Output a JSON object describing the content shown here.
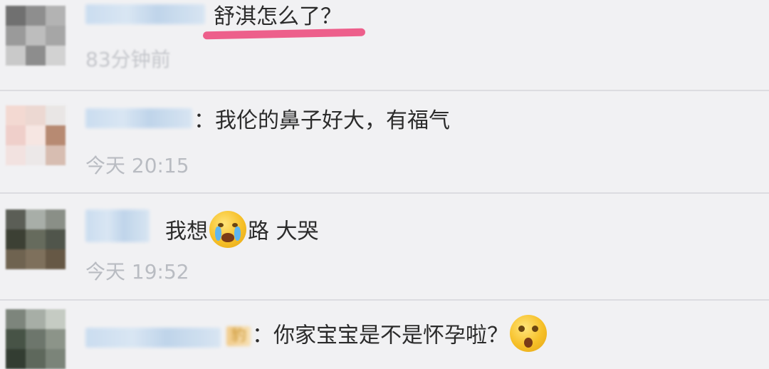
{
  "comments": [
    {
      "text": "舒淇怎么了？",
      "time": "83分钟前",
      "highlight_color": "#ec4f7f"
    },
    {
      "text": "：我伦的鼻子好大，有福气",
      "time": "今天 20:15"
    },
    {
      "text_before": "我想",
      "emoji": "crying-face-icon",
      "text_after": "路  大哭",
      "time": "今天 19:52"
    },
    {
      "partial_prefix": "豹",
      "text": "：你家宝宝是不是怀孕啦？",
      "emoji": "shocked-face-icon"
    }
  ]
}
